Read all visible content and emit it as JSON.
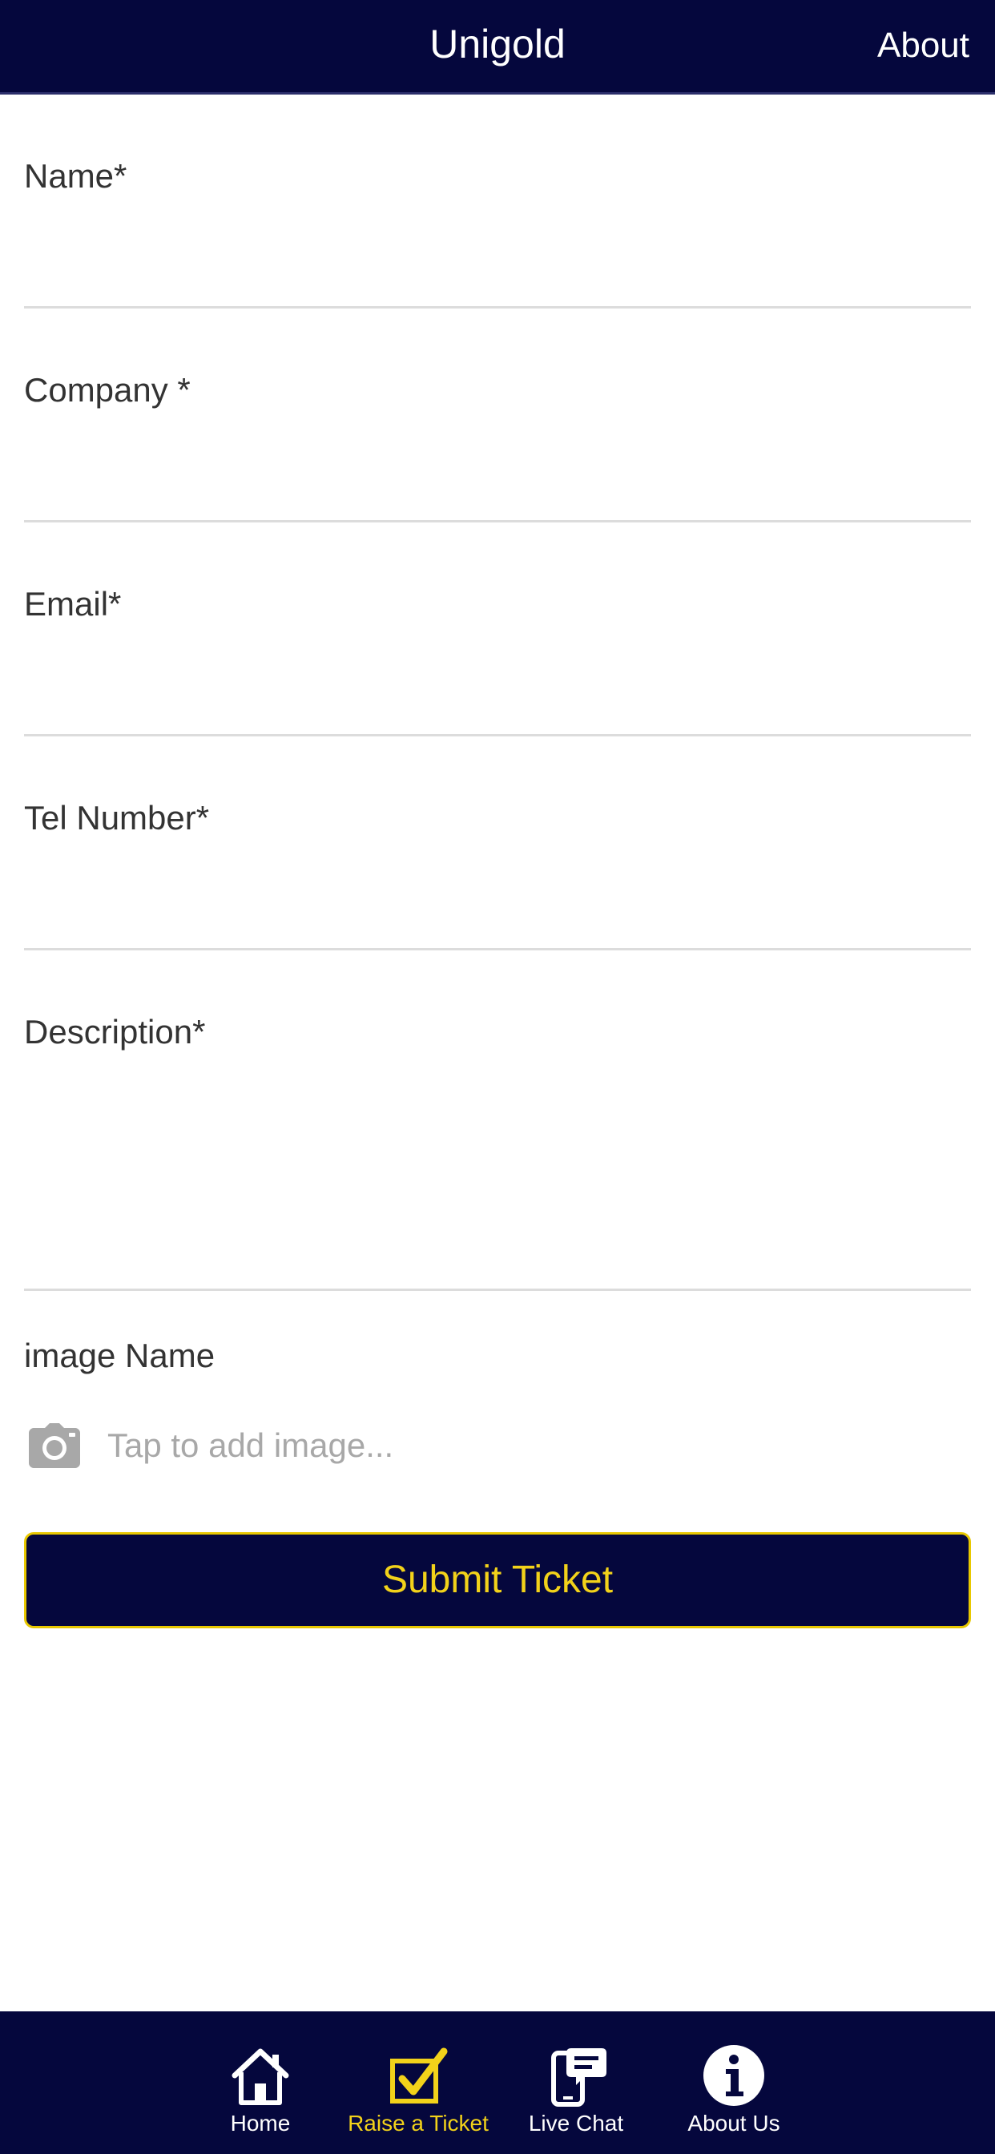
{
  "header": {
    "title": "Unigold",
    "about": "About"
  },
  "form": {
    "name": {
      "label": "Name*",
      "value": ""
    },
    "company": {
      "label": "Company *",
      "value": ""
    },
    "email": {
      "label": "Email*",
      "value": ""
    },
    "tel": {
      "label": "Tel Number*",
      "value": ""
    },
    "description": {
      "label": "Description*",
      "value": ""
    },
    "image": {
      "label": "image Name",
      "placeholder": "Tap to add image..."
    },
    "submit_label": "Submit Ticket"
  },
  "tabs": [
    {
      "label": "Home",
      "icon": "home-icon",
      "active": false
    },
    {
      "label": "Raise a Ticket",
      "icon": "checkbox-icon",
      "active": true
    },
    {
      "label": "Live Chat",
      "icon": "chat-phone-icon",
      "active": false
    },
    {
      "label": "About Us",
      "icon": "info-icon",
      "active": false
    }
  ],
  "colors": {
    "navy": "#05073d",
    "accent_yellow": "#f2d21a",
    "label_text": "#333333",
    "hint_text": "#a8a8a8",
    "divider": "#dcdcdc"
  }
}
